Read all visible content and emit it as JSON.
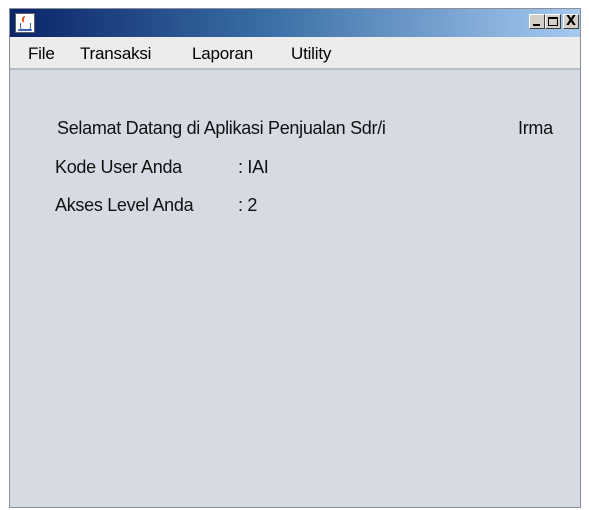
{
  "window": {
    "title": "",
    "icon": "java-coffee-cup-icon",
    "controls": {
      "minimize_icon": "minimize-icon",
      "maximize_icon": "maximize-icon",
      "close_label": "X"
    }
  },
  "menu": {
    "items": [
      "File",
      "Transaksi",
      "Laporan",
      "Utility"
    ]
  },
  "content": {
    "welcome_text": "Selamat Datang di Aplikasi Penjualan Sdr/i",
    "user_name": "Irma",
    "kode_label": "Kode User Anda",
    "kode_value": ": IAI",
    "akses_label": "Akses Level Anda",
    "akses_value": ": 2"
  },
  "colors": {
    "titlebar_start": "#0a246a",
    "titlebar_end": "#a6caf0",
    "background": "#d6dae3",
    "menubar": "#ececec"
  }
}
